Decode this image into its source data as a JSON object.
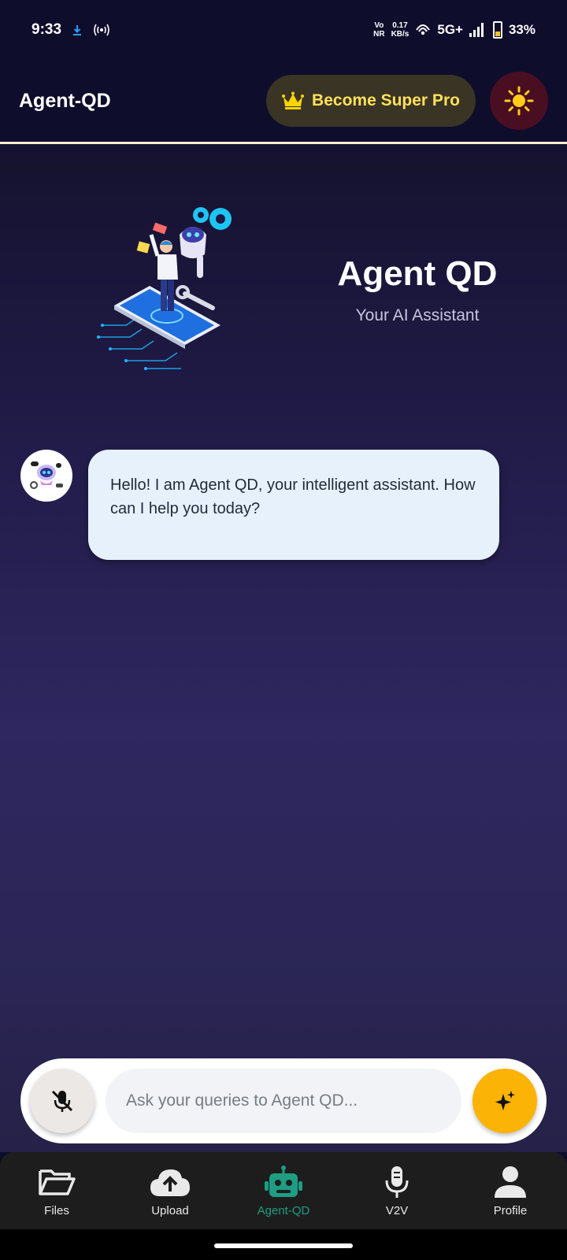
{
  "status_bar": {
    "time": "9:33",
    "network_top": "Vo",
    "network_bottom": "NR",
    "speed_top": "0.17",
    "speed_bottom": "KB/s",
    "network_type": "5G+",
    "battery": "33%"
  },
  "app_bar": {
    "title": "Agent-QD",
    "pro_label": "Become Super Pro"
  },
  "hero": {
    "title": "Agent QD",
    "subtitle": "Your AI Assistant"
  },
  "chat": {
    "messages": [
      {
        "sender": "bot",
        "text": "Hello! I am Agent QD, your intelligent assistant. How can I help you today?"
      }
    ]
  },
  "input": {
    "placeholder": "Ask your queries to Agent QD..."
  },
  "nav": {
    "items": [
      {
        "label": "Files",
        "icon": "folder-icon"
      },
      {
        "label": "Upload",
        "icon": "cloud-upload-icon"
      },
      {
        "label": "Agent-QD",
        "icon": "robot-icon",
        "active": true
      },
      {
        "label": "V2V",
        "icon": "microphone-icon"
      },
      {
        "label": "Profile",
        "icon": "person-icon"
      }
    ]
  },
  "colors": {
    "accent": "#fbb305",
    "active_nav": "#1e9d83",
    "pro_text": "#ffe15a",
    "bubble": "#e6f1fc"
  }
}
